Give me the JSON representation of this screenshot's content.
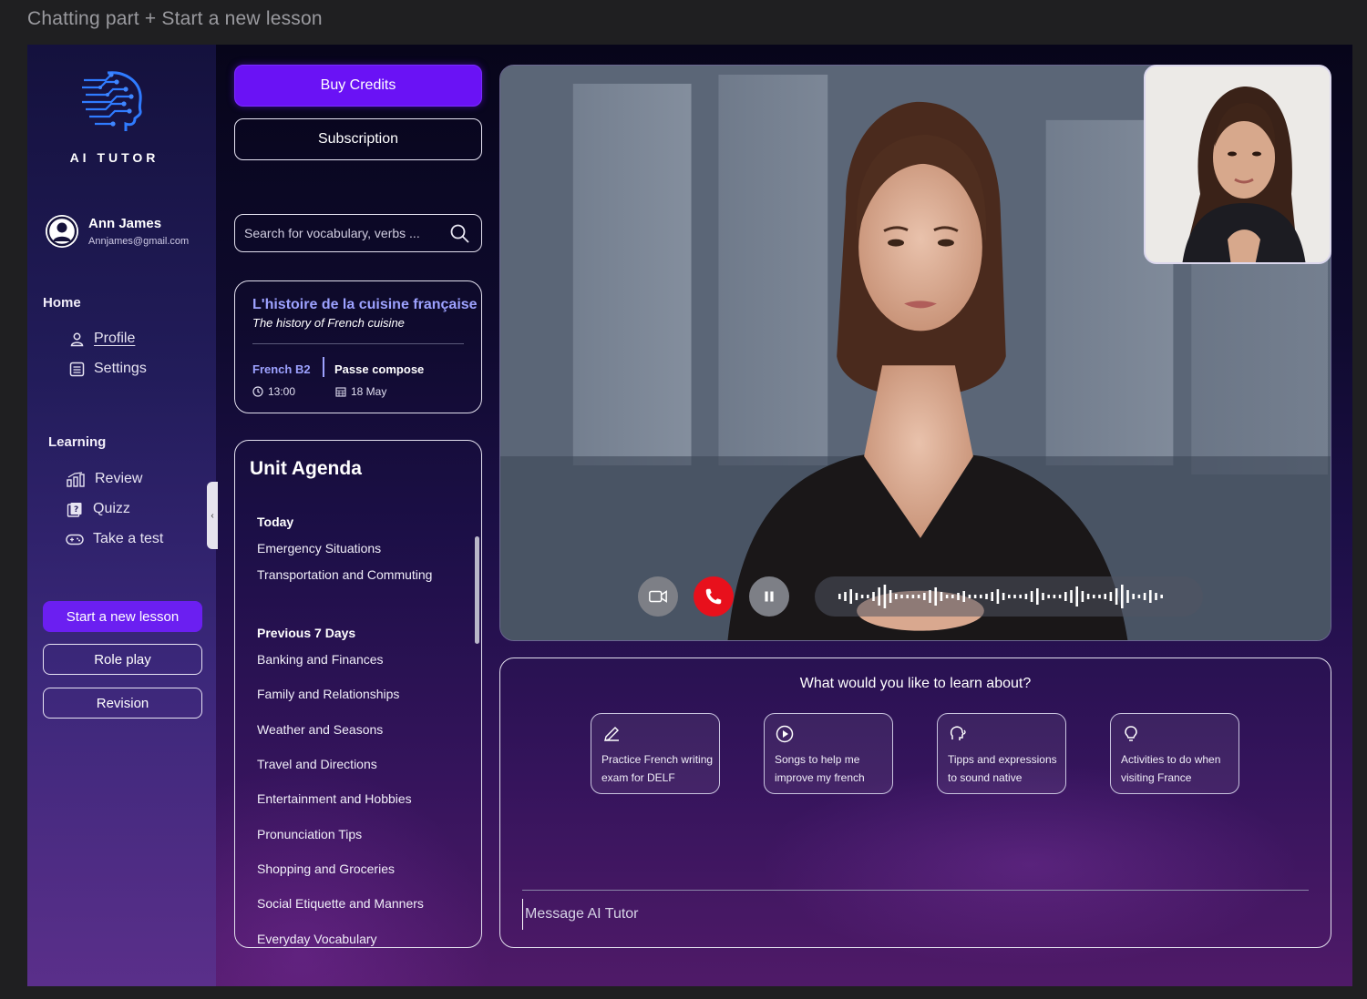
{
  "canvas_title": "Chatting part + Start a new lesson",
  "brand": {
    "name": "AI TUTOR"
  },
  "user": {
    "name": "Ann James",
    "email": "Annjames@gmail.com"
  },
  "nav": {
    "home_label": "Home",
    "home_items": [
      {
        "label": "Profile",
        "icon": "user-icon"
      },
      {
        "label": "Settings",
        "icon": "list-icon"
      }
    ],
    "learning_label": "Learning",
    "learning_items": [
      {
        "label": "Review",
        "icon": "bar-chart-icon"
      },
      {
        "label": "Quizz",
        "icon": "quiz-icon"
      },
      {
        "label": "Take a test",
        "icon": "gamepad-icon"
      }
    ]
  },
  "sidebar_buttons": {
    "start": "Start a new lesson",
    "role_play": "Role play",
    "revision": "Revision"
  },
  "top_buttons": {
    "buy": "Buy Credits",
    "subscription": "Subscription"
  },
  "search": {
    "placeholder": "Search for vocabulary, verbs ..."
  },
  "lesson": {
    "title": "L'histoire de la cuisine française",
    "subtitle": "The history of French cuisine",
    "level": "French B2",
    "topic": "Passe compose",
    "time": "13:00",
    "date": "18 May"
  },
  "agenda": {
    "title": "Unit Agenda",
    "today_label": "Today",
    "today": [
      "Emergency Situations",
      "Transportation and Commuting"
    ],
    "previous_label": "Previous 7 Days",
    "previous": [
      "Banking and Finances",
      "Family and Relationships",
      "Weather and Seasons",
      "Travel and Directions",
      "Entertainment and Hobbies",
      "Pronunciation Tips",
      "Shopping and Groceries",
      "Social Etiquette and Manners",
      "Everyday Vocabulary"
    ]
  },
  "call_controls": [
    "video-camera-icon",
    "hang-up-icon",
    "pause-icon"
  ],
  "colors": {
    "accent": "#6a12f5",
    "hangup": "#e8101c",
    "link": "#9da2ff"
  },
  "chat": {
    "question": "What would you like to learn about?",
    "suggestions": [
      {
        "text": "Practice French writing exam for DELF",
        "icon": "pencil-icon"
      },
      {
        "text": "Songs  to help me improve my french",
        "icon": "play-icon"
      },
      {
        "text": "Tipps and expressions to sound native",
        "icon": "speaking-head-icon"
      },
      {
        "text": "Activities to do when visiting France",
        "icon": "lightbulb-icon"
      }
    ],
    "placeholder": "Message AI Tutor"
  }
}
